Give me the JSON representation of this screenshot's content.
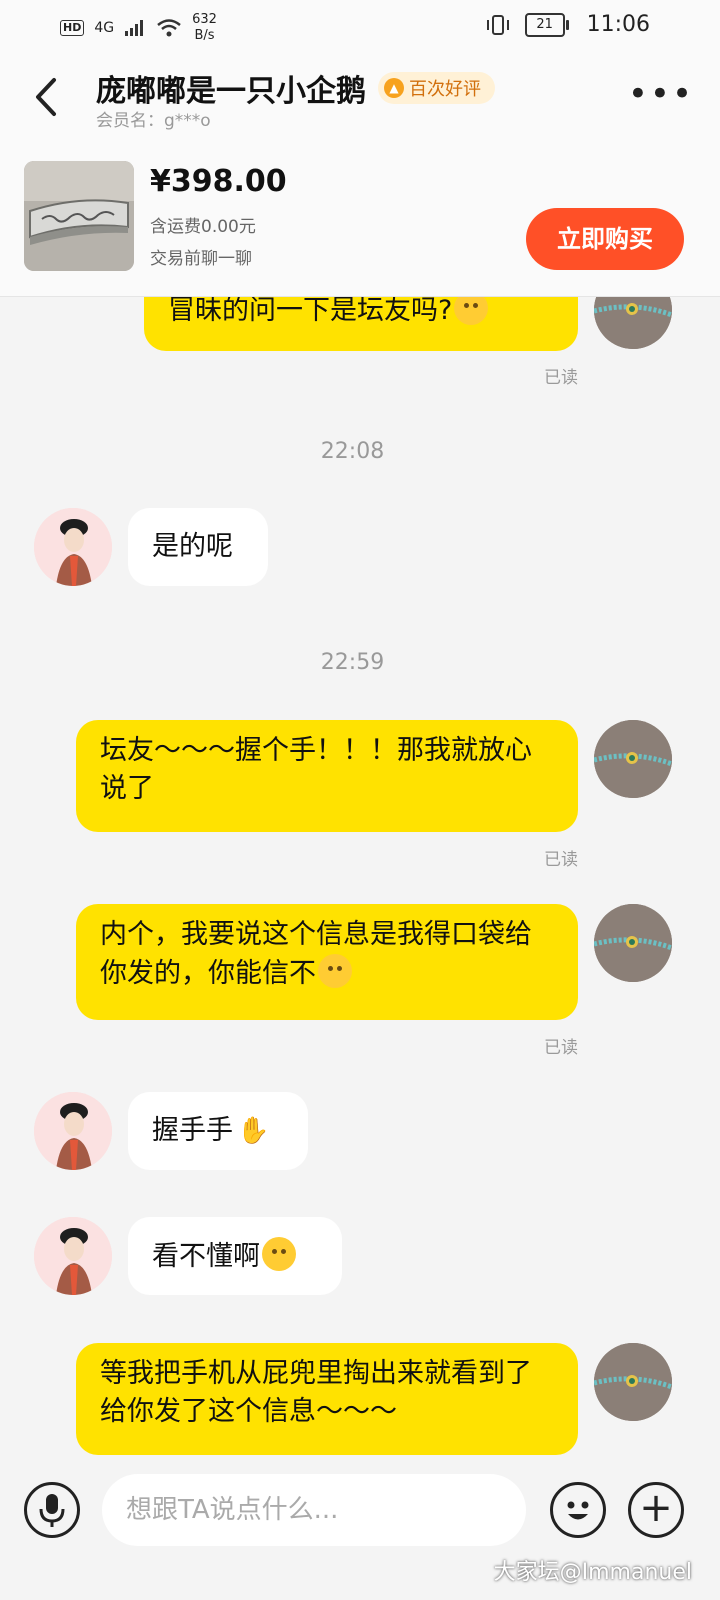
{
  "status_bar": {
    "hd": "HD",
    "network": "4G",
    "speed_value": "632",
    "speed_unit": "B/s",
    "battery": "21",
    "time": "11:06"
  },
  "header": {
    "title": "庞嘟嘟是一只小企鹅",
    "badge": "百次好评",
    "member": "会员名：g***o"
  },
  "product": {
    "price": "¥398.00",
    "shipping": "含运费0.00元",
    "chat_hint": "交易前聊一聊",
    "buy_label": "立即购买"
  },
  "messages": {
    "m1": "冒昧的问一下是坛友吗?",
    "t1": "22:08",
    "m2": "是的呢",
    "t2": "22:59",
    "m3": "坛友～～～握个手！！！那我就放心说了",
    "m4": "内个，我要说这个信息是我得口袋给你发的，你能信不",
    "m5": "握手手",
    "m6": "看不懂啊",
    "m7": "等我把手机从屁兜里掏出来就看到了给你发了这个信息～～～",
    "read": "已读"
  },
  "input": {
    "placeholder": "想跟TA说点什么..."
  },
  "watermark": "大家坛@Immanuel",
  "colors": {
    "my_bubble": "#ffe200",
    "their_bubble": "#ffffff",
    "buy_button": "#ff5027",
    "badge_text": "#d2700d"
  }
}
